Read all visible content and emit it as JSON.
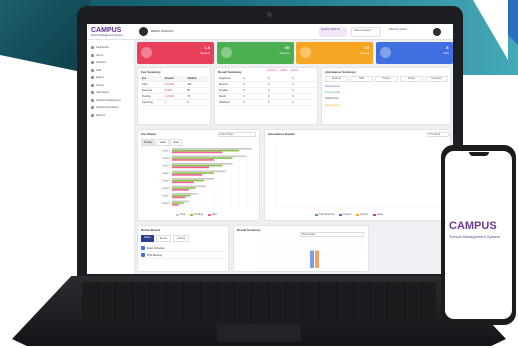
{
  "colors": {
    "brand": "#6b3c8e",
    "card_red": "#e8405a",
    "card_green": "#4caf50",
    "card_orange": "#f5a623",
    "card_blue": "#3f6fe0",
    "teal_banner": "#1a7080"
  },
  "app": {
    "logo_text": "CAMPUS",
    "logo_subtitle": "School Management System",
    "school_name": "DEMO SCHOOL"
  },
  "header": {
    "pill_1": "Session 2023-24",
    "pill_2": "Switch Session",
    "pill_3": "Welcome Admin",
    "user_icon": "avatar-icon"
  },
  "sidebar": {
    "items": [
      {
        "label": "Dashboard",
        "icon": "dashboard-icon"
      },
      {
        "label": "Admin",
        "icon": "admin-icon"
      },
      {
        "label": "Students",
        "icon": "students-icon"
      },
      {
        "label": "Staff",
        "icon": "staff-icon"
      },
      {
        "label": "Exams",
        "icon": "exams-icon"
      },
      {
        "label": "Library",
        "icon": "library-icon"
      },
      {
        "label": "Attendance",
        "icon": "attendance-icon"
      },
      {
        "label": "Student Management",
        "icon": "management-icon"
      },
      {
        "label": "Student Attendance",
        "icon": "calendar-icon"
      },
      {
        "label": "Reports",
        "icon": "reports-icon"
      }
    ]
  },
  "stat_cards": [
    {
      "value": "1.8",
      "label": "Students",
      "color": "#e8405a"
    },
    {
      "value": "60",
      "label": "Teachers",
      "color": "#4caf50"
    },
    {
      "value": "24",
      "label": "Classes",
      "color": "#f5a623"
    },
    {
      "value": "8",
      "label": "Staff",
      "color": "#3f6fe0"
    }
  ],
  "fee_summary": {
    "title": "Fee Summary",
    "columns": [
      "Fee",
      "Amount",
      "Student"
    ],
    "rows": [
      [
        "Total",
        "2,32,000",
        "150"
      ],
      [
        "Received",
        "92,000",
        "80"
      ],
      [
        "Pending",
        "1,40,000",
        "70"
      ],
      [
        "Upcoming",
        "0",
        "0"
      ]
    ]
  },
  "result_summary": {
    "title": "Result Summary",
    "tabs": [
      "Students",
      "Failed",
      "Exams"
    ],
    "rows": [
      [
        "Registered",
        "0",
        "0",
        "0"
      ],
      [
        "Entered",
        "0",
        "0",
        "0"
      ],
      [
        "Pending",
        "0",
        "0",
        "0"
      ],
      [
        "Result",
        "0",
        "0",
        "0"
      ],
      [
        "Published",
        "0",
        "0",
        "0"
      ]
    ]
  },
  "attendance_summary": {
    "title": "Attendance Summary",
    "boxes": [
      "Students",
      "Staff",
      "Present",
      "Absent",
      "Late Entry"
    ],
    "line_1": "Total Students",
    "line_2": "Present Today",
    "line_3": "Staff Present",
    "line_4": "Attendance %"
  },
  "fee_status": {
    "title": "Fee Status",
    "dropdown": "Select Class",
    "toggles": [
      "Monthly",
      "Yearly",
      "Class"
    ]
  },
  "attendance_graph": {
    "title": "Attendance Details",
    "dropdown": "This Week",
    "legend": [
      "Total Students",
      "Present",
      "Absent",
      "Leave"
    ]
  },
  "notice_board": {
    "title": "Notice Board",
    "tabs": [
      "Notice",
      "Events",
      "Circular"
    ],
    "items": [
      "Exam Schedule",
      "PTM Meeting"
    ]
  },
  "result_graph": {
    "title": "Result Summary",
    "dropdown": "Select Class"
  },
  "chart_data": [
    {
      "type": "bar",
      "title": "Fee Status",
      "categories": [
        "Class 1",
        "Class 2",
        "Class 3",
        "Class 4",
        "Class 5",
        "Class 6",
        "Class 7",
        "Class 8"
      ],
      "series": [
        {
          "name": "Total",
          "values": [
            95,
            88,
            72,
            64,
            50,
            40,
            30,
            20
          ],
          "color": "#c9c9c9"
        },
        {
          "name": "Pending",
          "values": [
            80,
            72,
            60,
            50,
            38,
            28,
            22,
            14
          ],
          "color": "#8bc34a"
        },
        {
          "name": "Paid",
          "values": [
            60,
            50,
            44,
            36,
            26,
            20,
            16,
            8
          ],
          "color": "#f06292"
        }
      ],
      "orientation": "horizontal",
      "xlim": [
        0,
        100
      ],
      "legend": [
        "Total",
        "Pending",
        "Paid"
      ],
      "legend_position": "bottom"
    },
    {
      "type": "bar",
      "title": "Result Summary",
      "categories": [
        "A",
        "B",
        "C"
      ],
      "series": [
        {
          "name": "Result",
          "values": [
            0,
            5,
            5
          ]
        }
      ],
      "bar_colors": [
        "#ffffff",
        "#7d9ce6",
        "#f4a261"
      ],
      "ylim": [
        0,
        8
      ]
    }
  ],
  "phone": {
    "logo_text": "CAMPUS",
    "logo_subtitle": "School Management System"
  }
}
